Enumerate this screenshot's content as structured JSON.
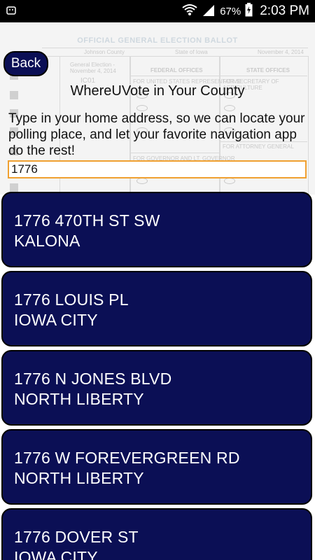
{
  "status_bar": {
    "battery_percent": "67%",
    "time": "2:03 PM",
    "icons": [
      "usb-debug-icon",
      "wifi-icon",
      "signal-icon",
      "battery-charging-icon"
    ]
  },
  "ballot_background": {
    "title": "OFFICIAL GENERAL ELECTION BALLOT",
    "county": "Johnson County",
    "state": "State of Iowa",
    "date": "November 4, 2014",
    "election": "General Election - November 4, 2014",
    "code": "IC01",
    "federal_offices": "FEDERAL OFFICES",
    "state_offices": "STATE OFFICES",
    "secretary_agriculture": "FOR SECRETARY OF AGRICULTURE",
    "us_representative": "FOR UNITED STATES REPRESENTATIVE",
    "attorney_general": "FOR ATTORNEY GENERAL",
    "governor": "FOR GOVERNOR AND LT. GOVERNOR"
  },
  "header": {
    "back_label": "Back",
    "title": "WhereUVote in Your County",
    "instructions": "Type in your home address, so we can locate your polling place, and let your favorite navigation app do the rest!"
  },
  "search": {
    "value": "1776"
  },
  "results": [
    {
      "street": "1776 470TH ST SW",
      "city": "KALONA"
    },
    {
      "street": "1776 LOUIS PL",
      "city": "IOWA CITY"
    },
    {
      "street": "1776 N JONES BLVD",
      "city": "NORTH LIBERTY"
    },
    {
      "street": "1776 W FOREVERGREEN RD",
      "city": "NORTH LIBERTY"
    },
    {
      "street": "1776 DOVER ST",
      "city": "IOWA CITY"
    }
  ]
}
